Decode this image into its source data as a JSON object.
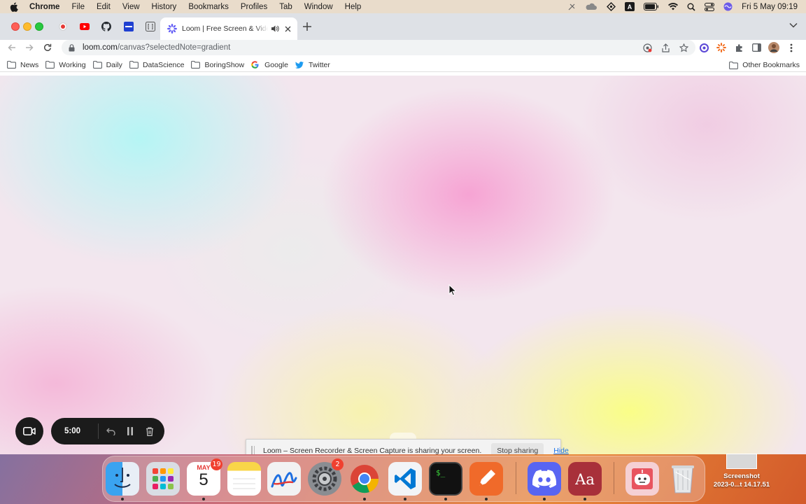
{
  "menubar": {
    "app_name": "Chrome",
    "menus": [
      "File",
      "Edit",
      "View",
      "History",
      "Bookmarks",
      "Profiles",
      "Tab",
      "Window",
      "Help"
    ],
    "clock": "Fri 5 May  09:19"
  },
  "browser": {
    "active_tab": {
      "title": "Loom | Free Screen & Video Recording"
    },
    "address": {
      "host": "loom.com",
      "path": "/canvas?selectedNote=gradient"
    },
    "bookmarks": [
      "News",
      "Working",
      "Daily",
      "DataScience",
      "BoringShow",
      "Google",
      "Twitter"
    ],
    "other_bookmarks": "Other Bookmarks"
  },
  "loom": {
    "timer": "5:00"
  },
  "share_notice": {
    "message": "Loom – Screen Recorder & Screen Capture is sharing your screen.",
    "stop_label": "Stop sharing",
    "hide_label": "Hide"
  },
  "dock": {
    "calendar_month": "MAY",
    "calendar_day": "5",
    "calendar_badge": "19",
    "settings_badge": "2"
  },
  "desktop": {
    "file_label_line1": "Screenshot",
    "file_label_line2": "2023-0...t 14.17.51"
  },
  "colors": {
    "menubar_bg": "#e9dccb",
    "tabstrip_bg": "#dee1e6",
    "loom_control_bg": "#1b1b1b",
    "link_blue": "#1a73e8"
  }
}
